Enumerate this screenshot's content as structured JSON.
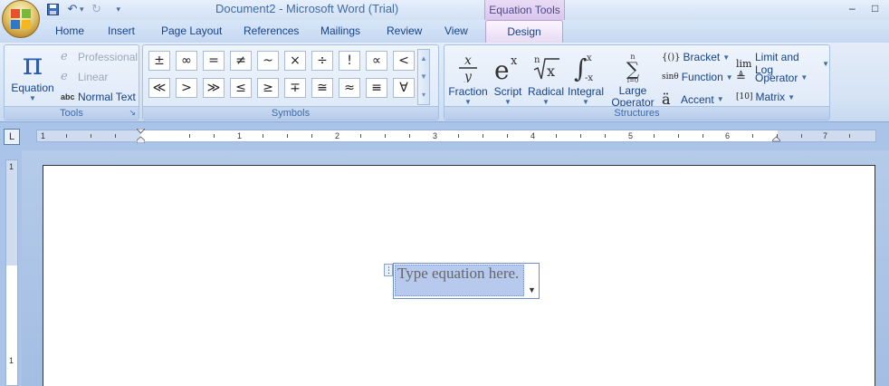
{
  "window": {
    "title": "Document2 - Microsoft Word (Trial)",
    "context_tab_group": "Equation Tools",
    "minimize": "–",
    "restore": "□"
  },
  "qat": {
    "save": "💾",
    "undo": "↶",
    "undo_dd": "▾",
    "redo": "↻",
    "custom": "▾"
  },
  "tabs": [
    "Home",
    "Insert",
    "Page Layout",
    "References",
    "Mailings",
    "Review",
    "View",
    "Design"
  ],
  "ribbon": {
    "tools": {
      "label": "Tools",
      "equation_glyph": "π",
      "equation_label": "Equation",
      "professional": "Professional",
      "linear": "Linear",
      "normal_text": "Normal Text",
      "abc": "abc",
      "launcher": "↘"
    },
    "symbols": {
      "label": "Symbols",
      "row1": [
        "±",
        "∞",
        "=",
        "≠",
        "~",
        "×",
        "÷",
        "!",
        "∝",
        "<"
      ],
      "row2": [
        "≪",
        ">",
        "≫",
        "≤",
        "≥",
        "∓",
        "≅",
        "≈",
        "≡",
        "∀"
      ]
    },
    "structures": {
      "label": "Structures",
      "fraction": "Fraction",
      "script": "Script",
      "radical": "Radical",
      "integral": "Integral",
      "large_operator_1": "Large",
      "large_operator_2": "Operator",
      "bracket": "Bracket",
      "function": "Function",
      "accent": "Accent",
      "limit_and_log": "Limit and Log",
      "operator": "Operator",
      "matrix": "Matrix"
    }
  },
  "ruler": {
    "numbers": [
      "1",
      "1",
      "2",
      "3",
      "4",
      "5",
      "6",
      "7"
    ],
    "vnumbers": [
      "1",
      "1"
    ],
    "corner": "L"
  },
  "document": {
    "placeholder": "Type equation here."
  }
}
